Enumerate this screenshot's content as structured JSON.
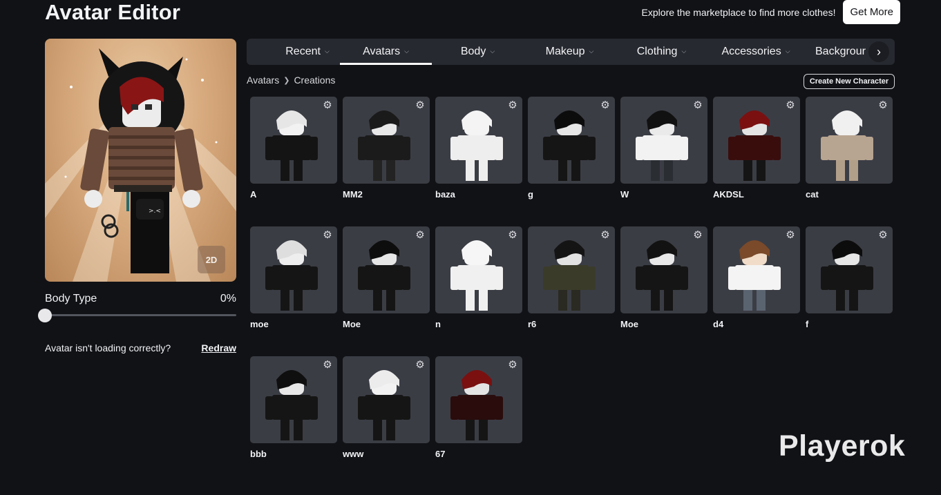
{
  "header": {
    "title": "Avatar Editor",
    "marketplace_text": "Explore the marketplace to find more clothes!",
    "get_more_label": "Get More"
  },
  "preview": {
    "toggle_label": "2D"
  },
  "body_type": {
    "label": "Body Type",
    "value_text": "0%",
    "value": 0
  },
  "loading": {
    "text": "Avatar isn't loading correctly?",
    "redraw_label": "Redraw"
  },
  "tabs": [
    {
      "label": "Recent",
      "active": false
    },
    {
      "label": "Avatars",
      "active": true
    },
    {
      "label": "Body",
      "active": false
    },
    {
      "label": "Makeup",
      "active": false
    },
    {
      "label": "Clothing",
      "active": false
    },
    {
      "label": "Accessories",
      "active": false
    },
    {
      "label": "Backgrour",
      "active": false
    }
  ],
  "breadcrumb": [
    "Avatars",
    "Creations"
  ],
  "create_button_label": "Create New Character",
  "avatars": [
    {
      "name": "A",
      "skin": "#f2f2f2",
      "hair": "#e6e6e6",
      "shirt": "#141414",
      "pants": "#141414"
    },
    {
      "name": "MM2",
      "skin": "#e8e8e8",
      "hair": "#1a1a1a",
      "shirt": "#1b1b1b",
      "pants": "#232323"
    },
    {
      "name": "baza",
      "skin": "#f4f4f4",
      "hair": "#f4f4f4",
      "shirt": "#eeeeee",
      "pants": "#eeeeee"
    },
    {
      "name": "g",
      "skin": "#e6e6e6",
      "hair": "#0c0c0c",
      "shirt": "#151515",
      "pants": "#151515"
    },
    {
      "name": "W",
      "skin": "#eaeaea",
      "hair": "#111111",
      "shirt": "#f2f2f2",
      "pants": "#2a2e33"
    },
    {
      "name": "AKDSL",
      "skin": "#e4e4e4",
      "hair": "#7a1010",
      "shirt": "#3a0d0d",
      "pants": "#151515"
    },
    {
      "name": "cat",
      "skin": "#f0f0f0",
      "hair": "#f0f0f0",
      "shirt": "#b8a591",
      "pants": "#b29f8a"
    },
    {
      "name": "moe",
      "skin": "#eeeeee",
      "hair": "#dedede",
      "shirt": "#151515",
      "pants": "#151515"
    },
    {
      "name": "Moe",
      "skin": "#e6e6e6",
      "hair": "#0d0d0d",
      "shirt": "#151515",
      "pants": "#151515"
    },
    {
      "name": "n",
      "skin": "#f6f6f6",
      "hair": "#f6f6f6",
      "shirt": "#f0f0f0",
      "pants": "#f0f0f0"
    },
    {
      "name": "r6",
      "skin": "#e2e2e2",
      "hair": "#141414",
      "shirt": "#3b3b2a",
      "pants": "#2a2a22"
    },
    {
      "name": "Moe",
      "skin": "#e8e8e8",
      "hair": "#121212",
      "shirt": "#151515",
      "pants": "#151515"
    },
    {
      "name": "d4",
      "skin": "#f0dcc8",
      "hair": "#7a4a2a",
      "shirt": "#f4f4f4",
      "pants": "#5a6470"
    },
    {
      "name": "f",
      "skin": "#e6e6e6",
      "hair": "#0c0c0c",
      "shirt": "#151515",
      "pants": "#151515"
    },
    {
      "name": "bbb",
      "skin": "#e8e8e8",
      "hair": "#0f0f0f",
      "shirt": "#151515",
      "pants": "#151515"
    },
    {
      "name": "www",
      "skin": "#f2f2f2",
      "hair": "#ececec",
      "shirt": "#151515",
      "pants": "#151515"
    },
    {
      "name": "67",
      "skin": "#e4e4e4",
      "hair": "#7a1010",
      "shirt": "#2a0c0c",
      "pants": "#151515"
    }
  ],
  "watermark": "Playerok"
}
